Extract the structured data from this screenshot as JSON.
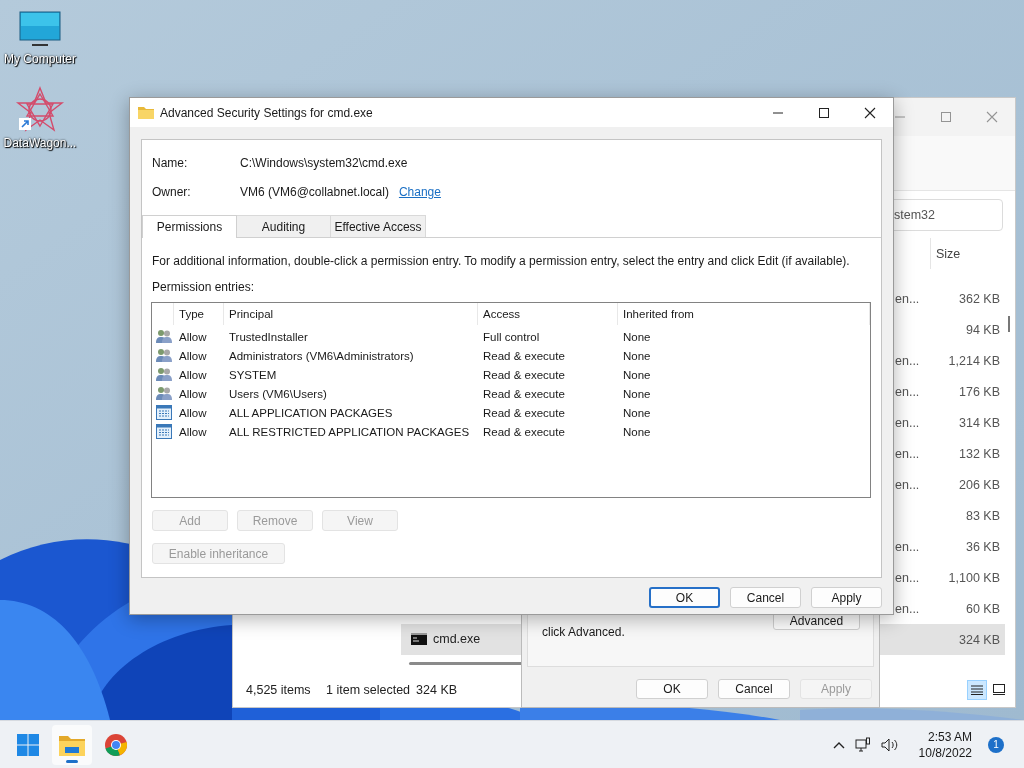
{
  "desktop": {
    "icons": [
      {
        "label": "My Computer",
        "kind": "computer"
      },
      {
        "label": "DataWagon...",
        "kind": "shortcut"
      }
    ]
  },
  "explorer": {
    "search": "stem32",
    "columns": [
      "Size"
    ],
    "rows": [
      {
        "name": "",
        "type": "en...",
        "size": "362 KB",
        "selected": false
      },
      {
        "name": "",
        "type": "",
        "size": "94 KB",
        "selected": false
      },
      {
        "name": "",
        "type": "en...",
        "size": "1,214 KB",
        "selected": false
      },
      {
        "name": "",
        "type": "en...",
        "size": "176 KB",
        "selected": false
      },
      {
        "name": "",
        "type": "en...",
        "size": "314 KB",
        "selected": false
      },
      {
        "name": "",
        "type": "en...",
        "size": "132 KB",
        "selected": false
      },
      {
        "name": "",
        "type": "en...",
        "size": "206 KB",
        "selected": false
      },
      {
        "name": "",
        "type": "",
        "size": "83 KB",
        "selected": false
      },
      {
        "name": "",
        "type": "en...",
        "size": "36 KB",
        "selected": false
      },
      {
        "name": "",
        "type": "en...",
        "size": "1,100 KB",
        "selected": false
      },
      {
        "name": "",
        "type": "en...",
        "size": "60 KB",
        "selected": false
      },
      {
        "name": "cmd.exe",
        "type": "",
        "size": "324 KB",
        "selected": true
      }
    ],
    "status": {
      "count": "4,525 items",
      "selection": "1 item selected",
      "size": "324 KB"
    },
    "views": [
      {
        "kind": "details",
        "selected": true
      },
      {
        "kind": "tiles",
        "selected": false
      }
    ]
  },
  "properties_dialog": {
    "text": "click Advanced.",
    "advanced_button": "Advanced",
    "buttons": [
      {
        "label": "OK",
        "disabled": false
      },
      {
        "label": "Cancel",
        "disabled": false
      },
      {
        "label": "Apply",
        "disabled": true
      }
    ]
  },
  "security_dialog": {
    "title": "Advanced Security Settings for cmd.exe",
    "name_label": "Name:",
    "name_value": "C:\\Windows\\system32\\cmd.exe",
    "owner_label": "Owner:",
    "owner_value": "VM6 (VM6@collabnet.local)",
    "owner_link": "Change",
    "tabs": [
      {
        "label": "Permissions",
        "selected": true
      },
      {
        "label": "Auditing",
        "selected": false
      },
      {
        "label": "Effective Access",
        "selected": false
      }
    ],
    "info": "For additional information, double-click a permission entry. To modify a permission entry, select the entry and click Edit (if available).",
    "entries_label": "Permission entries:",
    "columns": [
      "Type",
      "Principal",
      "Access",
      "Inherited from"
    ],
    "entries": [
      {
        "kind": "group",
        "type": "Allow",
        "principal": "TrustedInstaller",
        "access": "Full control",
        "inherited": "None"
      },
      {
        "kind": "group",
        "type": "Allow",
        "principal": "Administrators (VM6\\Administrators)",
        "access": "Read & execute",
        "inherited": "None"
      },
      {
        "kind": "group",
        "type": "Allow",
        "principal": "SYSTEM",
        "access": "Read & execute",
        "inherited": "None"
      },
      {
        "kind": "group",
        "type": "Allow",
        "principal": "Users (VM6\\Users)",
        "access": "Read & execute",
        "inherited": "None"
      },
      {
        "kind": "package",
        "type": "Allow",
        "principal": "ALL APPLICATION PACKAGES",
        "access": "Read & execute",
        "inherited": "None"
      },
      {
        "kind": "package",
        "type": "Allow",
        "principal": "ALL RESTRICTED APPLICATION PACKAGES",
        "access": "Read & execute",
        "inherited": "None"
      }
    ],
    "entry_buttons": [
      {
        "label": "Add",
        "disabled": true
      },
      {
        "label": "Remove",
        "disabled": true
      },
      {
        "label": "View",
        "disabled": true
      }
    ],
    "inheritance_button": {
      "label": "Enable inheritance",
      "disabled": true
    },
    "buttons": [
      {
        "label": "OK",
        "default": true,
        "disabled": false
      },
      {
        "label": "Cancel",
        "default": false,
        "disabled": false
      },
      {
        "label": "Apply",
        "default": false,
        "disabled": false
      }
    ]
  },
  "taskbar": {
    "apps": [
      {
        "kind": "start",
        "active": false
      },
      {
        "kind": "explorer",
        "active": true
      },
      {
        "kind": "browser",
        "active": false
      }
    ],
    "time": "2:53 AM",
    "date": "10/8/2022",
    "notifications": "1"
  }
}
